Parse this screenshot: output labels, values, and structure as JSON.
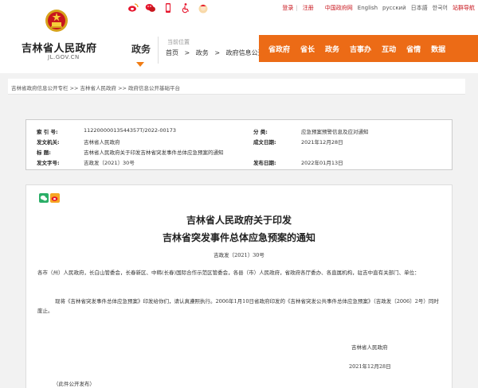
{
  "topbar": {
    "social_icons": [
      "weibo-icon",
      "wechat-icon",
      "mobile-icon",
      "accessibility-icon",
      "elder-mode-icon"
    ],
    "login": "登录",
    "register": "注册",
    "languages": [
      "中国政府网",
      "English",
      "русский",
      "日本語",
      "한국어"
    ],
    "easy_read": "站群导航"
  },
  "header": {
    "site_name": "吉林省人民政府",
    "domain": "JL.GOV.CN",
    "section": "政务",
    "location_label": "当前位置",
    "crumbs": [
      "首页",
      ">",
      "政务",
      ">",
      "政府信息公开"
    ],
    "nav": [
      "省政府",
      "省长",
      "政务",
      "吉事办",
      "互动",
      "省情",
      "数据"
    ]
  },
  "breadcrumb": {
    "text": "吉林省政府信息公开专栏 >> 吉林省人民政府 >> 政府信息公开基础平台"
  },
  "meta": {
    "index_label": "索  引  号:",
    "index_value": "11220000013544357T/2022-00173",
    "category_label": "分     类:",
    "category_value": "应急预案预警信息及应对通知",
    "issuer_label": "发文机关:",
    "issuer_value": "吉林省人民政府",
    "date_label": "成文日期:",
    "date_value": "2021年12月28日",
    "title_label": "标     题:",
    "title_value": "吉林省人民政府关于印发吉林省突发事件总体应急预案的通知",
    "docno_label": "发文字号:",
    "docno_value": "吉政发〔2021〕30号",
    "pubdate_label": "发布日期:",
    "pubdate_value": "2022年01月13日"
  },
  "document": {
    "title_line1": "吉林省人民政府关于印发",
    "title_line2": "吉林省突发事件总体应急预案的通知",
    "doc_number": "吉政发〔2021〕30号",
    "para1": "各市（州）人民政府，长白山管委会，长春新区、中韩(长春)国际合作示范区管委会，各县（市）人民政府，省政府各厅委办、各直属机构，驻吉中直有关部门、单位：",
    "para2": "现将《吉林省突发事件总体应急预案》印发给你们，请认真遵照执行。2006年1月10日省政府印发的《吉林省突发公共事件总体应急预案》（吉政发〔2006〕2号）同时废止。",
    "signature": "吉林省人民政府",
    "sign_date": "2021年12月28日",
    "footer_note": "（此件公开发布）"
  },
  "colors": {
    "accent_orange": "#ec6b16",
    "link_red": "#c8161d"
  }
}
